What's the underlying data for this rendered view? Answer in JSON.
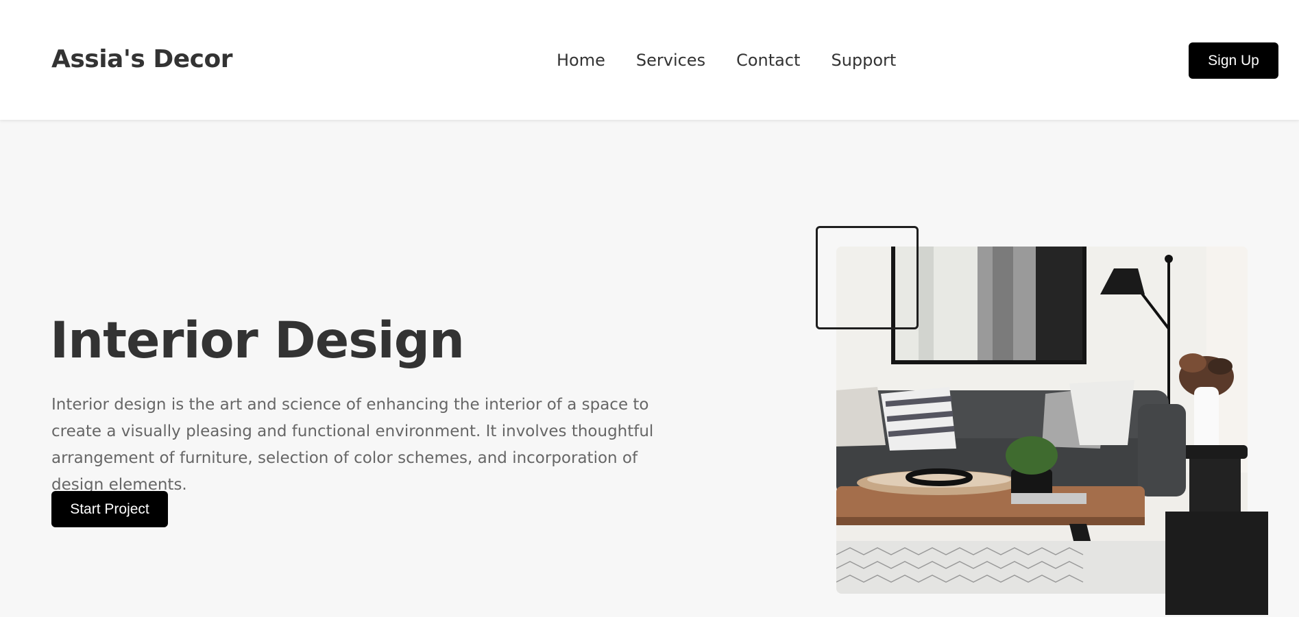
{
  "header": {
    "logo": "Assia's Decor",
    "nav": [
      {
        "label": "Home"
      },
      {
        "label": "Services"
      },
      {
        "label": "Contact"
      },
      {
        "label": "Support"
      }
    ],
    "signup_label": "Sign Up"
  },
  "hero": {
    "title": "Interior Design",
    "description": "Interior design is the art and science of enhancing the interior of a space to create a visually pleasing and functional environment. It involves thoughtful arrangement of furniture, selection of color schemes, and incorporation of design elements.",
    "cta_label": "Start Project"
  },
  "colors": {
    "page_background": "#f7f7f7",
    "header_background": "#ffffff",
    "button_background": "#000000",
    "text_dark": "#333333",
    "text_muted": "#666666"
  }
}
